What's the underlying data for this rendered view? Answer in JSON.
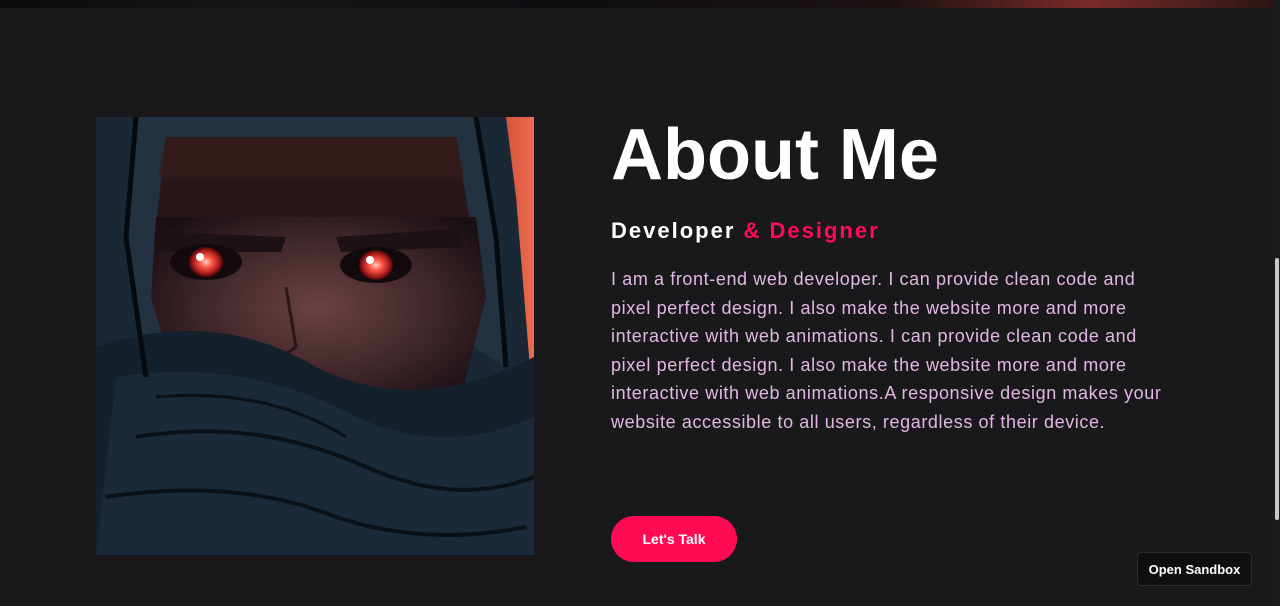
{
  "about": {
    "title": "About Me",
    "subtitle_primary": "Developer",
    "subtitle_accent": "& Designer",
    "bio": "I am a front-end web developer. I can provide clean code and pixel perfect design. I also make the website more and more interactive with web animations. I can provide clean code and pixel perfect design. I also make the website more and more interactive with web animations.A responsive design makes your website accessible to all users, regardless of their device.",
    "cta_label": "Let's Talk"
  },
  "sandbox": {
    "label": "Open Sandbox"
  },
  "colors": {
    "background": "#19191b",
    "accent": "#ff0a54",
    "bio_text": "#e3b7e3",
    "heading": "#ffffff"
  },
  "icons": {
    "portrait": "hooded-figure-illustration"
  }
}
